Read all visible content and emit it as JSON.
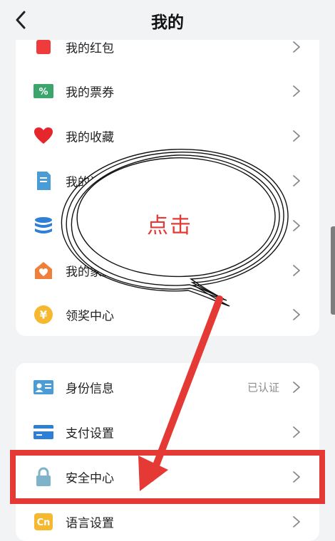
{
  "header": {
    "title": "我的"
  },
  "group1": {
    "items": [
      {
        "label": "我的红包"
      },
      {
        "label": "我的票券"
      },
      {
        "label": "我的收藏"
      },
      {
        "label": "我的订单"
      },
      {
        "label": "我的资产"
      },
      {
        "label": "我的家庭"
      },
      {
        "label": "领奖中心"
      }
    ]
  },
  "group2": {
    "items": [
      {
        "label": "身份信息",
        "status": "已认证"
      },
      {
        "label": "支付设置"
      },
      {
        "label": "安全中心"
      },
      {
        "label": "语言设置"
      }
    ]
  },
  "annotation": {
    "bubble_text": "点击"
  },
  "colors": {
    "highlight": "#e53935",
    "background": "#f2f3f5"
  }
}
